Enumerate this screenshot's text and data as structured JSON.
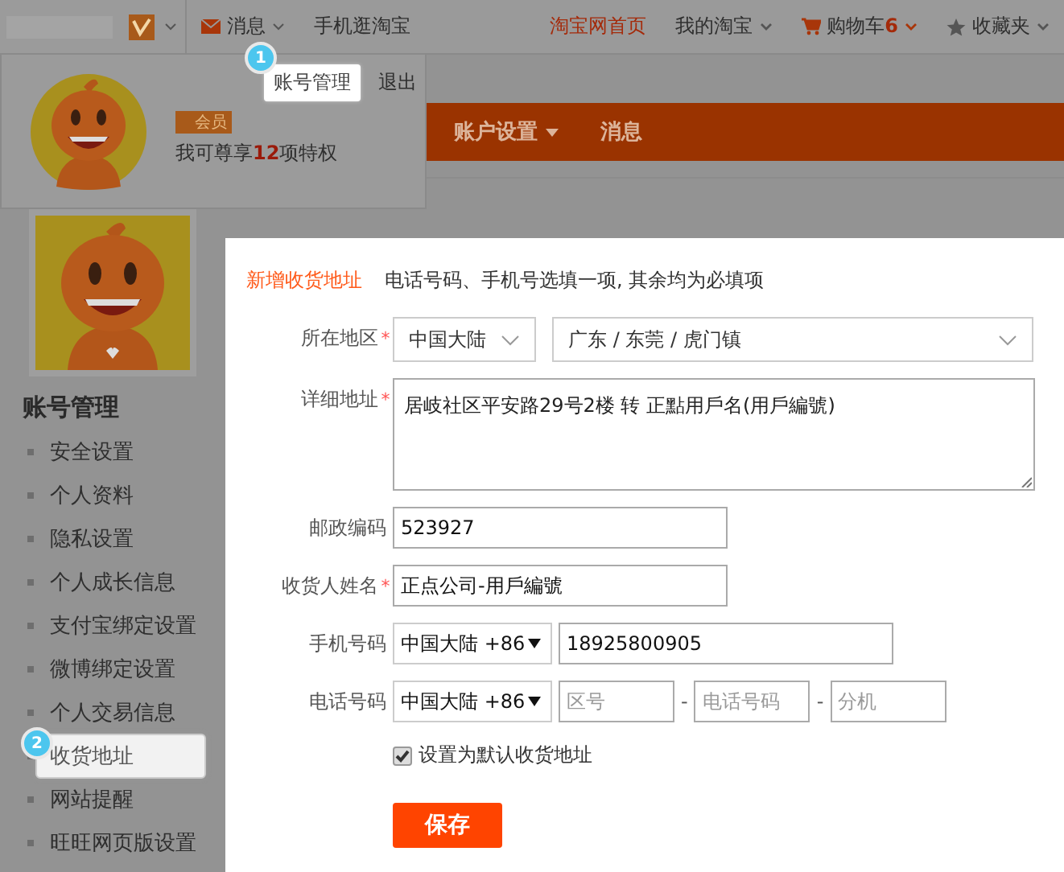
{
  "top_nav": {
    "left": [
      {
        "label": "消息",
        "kind": "mail"
      },
      {
        "label": "手机逛淘宝",
        "kind": "plain"
      }
    ],
    "right": [
      {
        "label": "淘宝网首页",
        "kind": "home"
      },
      {
        "label": "我的淘宝",
        "kind": "dropdown"
      },
      {
        "label": "购物车",
        "count": "6",
        "kind": "cart"
      },
      {
        "label": "收藏夹",
        "kind": "star"
      }
    ]
  },
  "account_popup": {
    "links": [
      {
        "label": "账号管理",
        "highlighted": true,
        "step": "1"
      },
      {
        "label": "退出",
        "highlighted": false
      }
    ],
    "badge": "会员",
    "privilege": "我可尊享**12**项特权"
  },
  "main_nav": [
    {
      "label": "账户设置",
      "kind": "dropdown"
    },
    {
      "label": "消息",
      "kind": "plain"
    }
  ],
  "sidebar": {
    "title": "账号管理",
    "items": [
      {
        "label": "安全设置",
        "selected": false
      },
      {
        "label": "个人资料",
        "selected": false
      },
      {
        "label": "隐私设置",
        "selected": false
      },
      {
        "label": "个人成长信息",
        "selected": false
      },
      {
        "label": "支付宝绑定设置",
        "selected": false
      },
      {
        "label": "微博绑定设置",
        "selected": false
      },
      {
        "label": "个人交易信息",
        "selected": false
      },
      {
        "label": "收货地址",
        "selected": true,
        "step": "2"
      },
      {
        "label": "网站提醒",
        "selected": false
      },
      {
        "label": "旺旺网页版设置",
        "selected": false
      }
    ]
  },
  "form": {
    "title": "新增收货地址",
    "required_mark": "*",
    "note": "电话号码、手机号选填一项, 其余均为必填项",
    "fields": [
      {
        "kind": "region",
        "label": "所在地区",
        "required": true,
        "country": "中国大陆",
        "area": "广东 / 东莞 / 虎门镇"
      },
      {
        "kind": "textarea",
        "label": "详细地址",
        "required": true,
        "value": "居岐社区平安路29号2楼 转 正點用戶名(用戶編號)"
      },
      {
        "kind": "text",
        "label": "邮政编码",
        "required": false,
        "value": "523927"
      },
      {
        "kind": "text",
        "label": "收货人姓名",
        "required": true,
        "value": "正点公司-用戶編號"
      },
      {
        "kind": "mobile",
        "label": "手机号码",
        "required": false,
        "country_code": "中国大陆 +86",
        "value": "18925800905"
      },
      {
        "kind": "phone",
        "label": "电话号码",
        "required": false,
        "country_code": "中国大陆 +86",
        "placeholders": [
          "区号",
          "电话号码",
          "分机"
        ],
        "separator": "-"
      }
    ],
    "default_checkbox": {
      "label": "设置为默认收货地址",
      "checked": true
    },
    "save_button": "保存"
  }
}
